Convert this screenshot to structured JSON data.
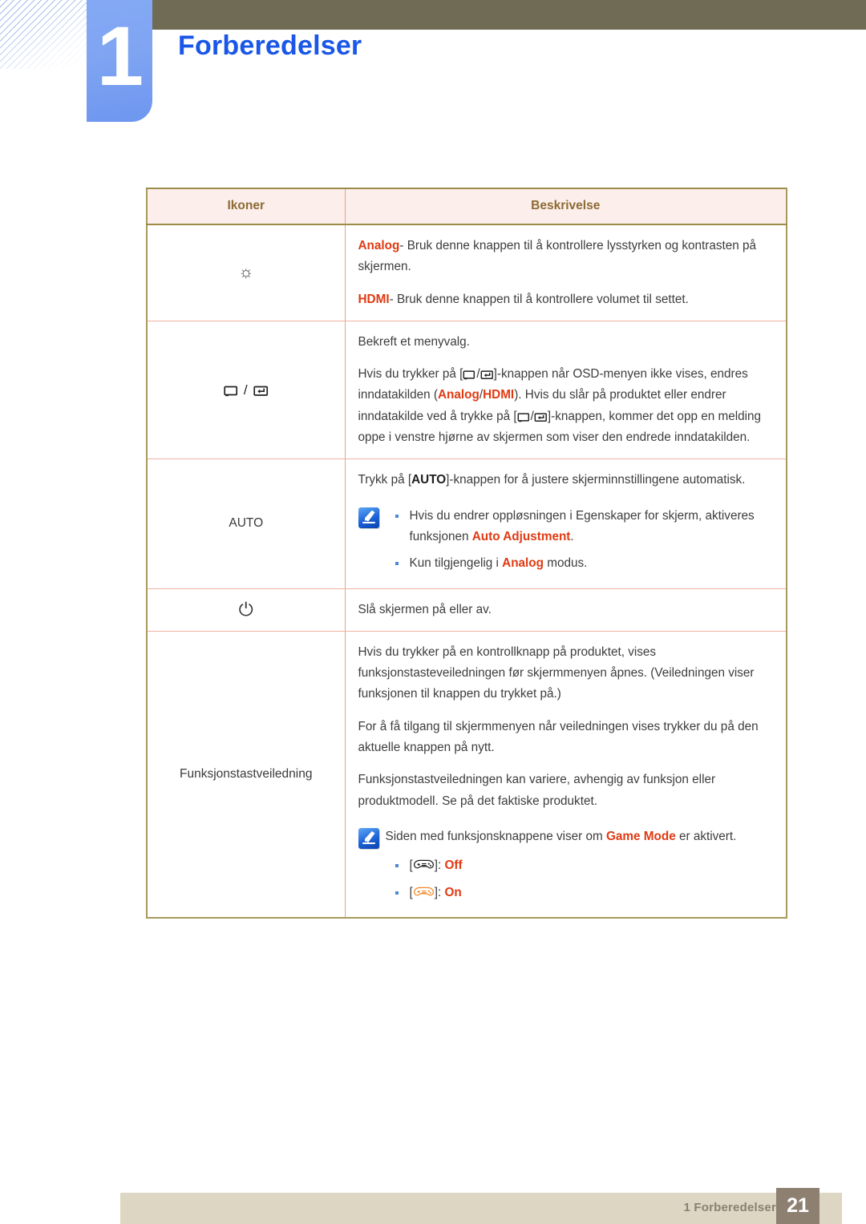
{
  "header": {
    "chapter_number": "1",
    "chapter_title": "Forberedelser"
  },
  "table": {
    "columns": [
      "Ikoner",
      "Beskrivelse"
    ],
    "rows": [
      {
        "icon_name": "brightness-sun-icon",
        "icon_label": "",
        "paragraphs": [
          {
            "segments": [
              {
                "text": "Analog",
                "style": "red-bold"
              },
              {
                "text": "- Bruk denne knappen til å kontrollere lysstyrken og kontrasten på skjermen.",
                "style": "normal"
              }
            ]
          },
          {
            "segments": [
              {
                "text": "HDMI",
                "style": "red-bold"
              },
              {
                "text": "- Bruk denne knappen til å kontrollere volumet til settet.",
                "style": "normal"
              }
            ]
          }
        ]
      },
      {
        "icon_name": "source-enter-icon",
        "icon_label": "",
        "paragraphs": [
          {
            "segments": [
              {
                "text": "Bekreft et menyvalg.",
                "style": "normal"
              }
            ]
          },
          {
            "segments": [
              {
                "text": "Hvis du trykker på [",
                "style": "normal"
              },
              {
                "text": "SOURCE/ENTER",
                "style": "icon-pair"
              },
              {
                "text": "]-knappen når OSD-menyen ikke vises, endres inndatakilden (",
                "style": "normal"
              },
              {
                "text": "Analog",
                "style": "red-bold"
              },
              {
                "text": "/",
                "style": "normal"
              },
              {
                "text": "HDMI",
                "style": "red-bold"
              },
              {
                "text": "). Hvis du slår på produktet eller endrer inndatakilde ved å trykke på [",
                "style": "normal"
              },
              {
                "text": "SOURCE/ENTER",
                "style": "icon-pair"
              },
              {
                "text": "]-knappen, kommer det opp en melding oppe i venstre hjørne av skjermen som viser den endrede inndatakilden.",
                "style": "normal"
              }
            ]
          }
        ]
      },
      {
        "icon_name": "auto-button-label",
        "icon_label": "AUTO",
        "paragraphs": [
          {
            "segments": [
              {
                "text": "Trykk på [",
                "style": "normal"
              },
              {
                "text": "AUTO",
                "style": "bold-dark"
              },
              {
                "text": "]-knappen for å justere skjerminnstillingene automatisk.",
                "style": "normal"
              }
            ]
          }
        ],
        "note": {
          "icon_name": "note-pen-icon",
          "items": [
            {
              "segments": [
                {
                  "text": "Hvis du endrer oppløsningen i Egenskaper for skjerm, aktiveres funksjonen ",
                  "style": "normal"
                },
                {
                  "text": "Auto Adjustment",
                  "style": "red-bold"
                },
                {
                  "text": ".",
                  "style": "normal"
                }
              ]
            },
            {
              "segments": [
                {
                  "text": "Kun tilgjengelig i ",
                  "style": "normal"
                },
                {
                  "text": "Analog",
                  "style": "red-bold"
                },
                {
                  "text": " modus.",
                  "style": "normal"
                }
              ]
            }
          ]
        }
      },
      {
        "icon_name": "power-icon",
        "icon_label": "",
        "paragraphs": [
          {
            "segments": [
              {
                "text": "Slå skjermen på eller av.",
                "style": "normal"
              }
            ]
          }
        ]
      },
      {
        "icon_name": "function-key-guide-label",
        "icon_label": "Funksjonstastveiledning",
        "paragraphs": [
          {
            "segments": [
              {
                "text": "Hvis du trykker på en kontrollknapp på produktet, vises funksjonstasteveiledningen før skjermmenyen åpnes. (Veiledningen viser funksjonen til knappen du trykket på.)",
                "style": "normal"
              }
            ]
          },
          {
            "segments": [
              {
                "text": "For å få tilgang til skjermmenyen når veiledningen vises trykker du på den aktuelle knappen på nytt.",
                "style": "normal"
              }
            ]
          },
          {
            "segments": [
              {
                "text": "Funksjonstastveiledningen kan variere, avhengig av funksjon eller produktmodell. Se på det faktiske produktet.",
                "style": "normal"
              }
            ]
          }
        ],
        "note": {
          "icon_name": "note-pen-icon",
          "lead": {
            "segments": [
              {
                "text": "Siden med funksjonsknappene viser om ",
                "style": "normal"
              },
              {
                "text": "Game Mode",
                "style": "red-bold"
              },
              {
                "text": " er aktivert.",
                "style": "normal"
              }
            ]
          },
          "items": [
            {
              "gamepad": "black",
              "segments": [
                {
                  "text": "[",
                  "style": "normal"
                },
                {
                  "text": "GAMEPAD",
                  "style": "gamepad-black"
                },
                {
                  "text": "]: ",
                  "style": "normal"
                },
                {
                  "text": "Off",
                  "style": "red-bold"
                }
              ]
            },
            {
              "gamepad": "orange",
              "segments": [
                {
                  "text": "[",
                  "style": "normal"
                },
                {
                  "text": "GAMEPAD",
                  "style": "gamepad-orange"
                },
                {
                  "text": "]: ",
                  "style": "normal"
                },
                {
                  "text": "On",
                  "style": "red-bold"
                }
              ]
            }
          ]
        }
      }
    ]
  },
  "footer": {
    "section_label": "1 Forberedelser",
    "page_number": "21"
  },
  "colors": {
    "accent_blue": "#1a57e8",
    "keyword_red": "#e03a12",
    "table_border": "#a89a5c",
    "table_inner_border": "#f0b2a0",
    "header_bg": "#fcefeb",
    "header_text": "#8d6a34",
    "olive_bar": "#6f6b55",
    "footer_bar": "#dcd6c2",
    "footer_page_box": "#8d8071"
  }
}
